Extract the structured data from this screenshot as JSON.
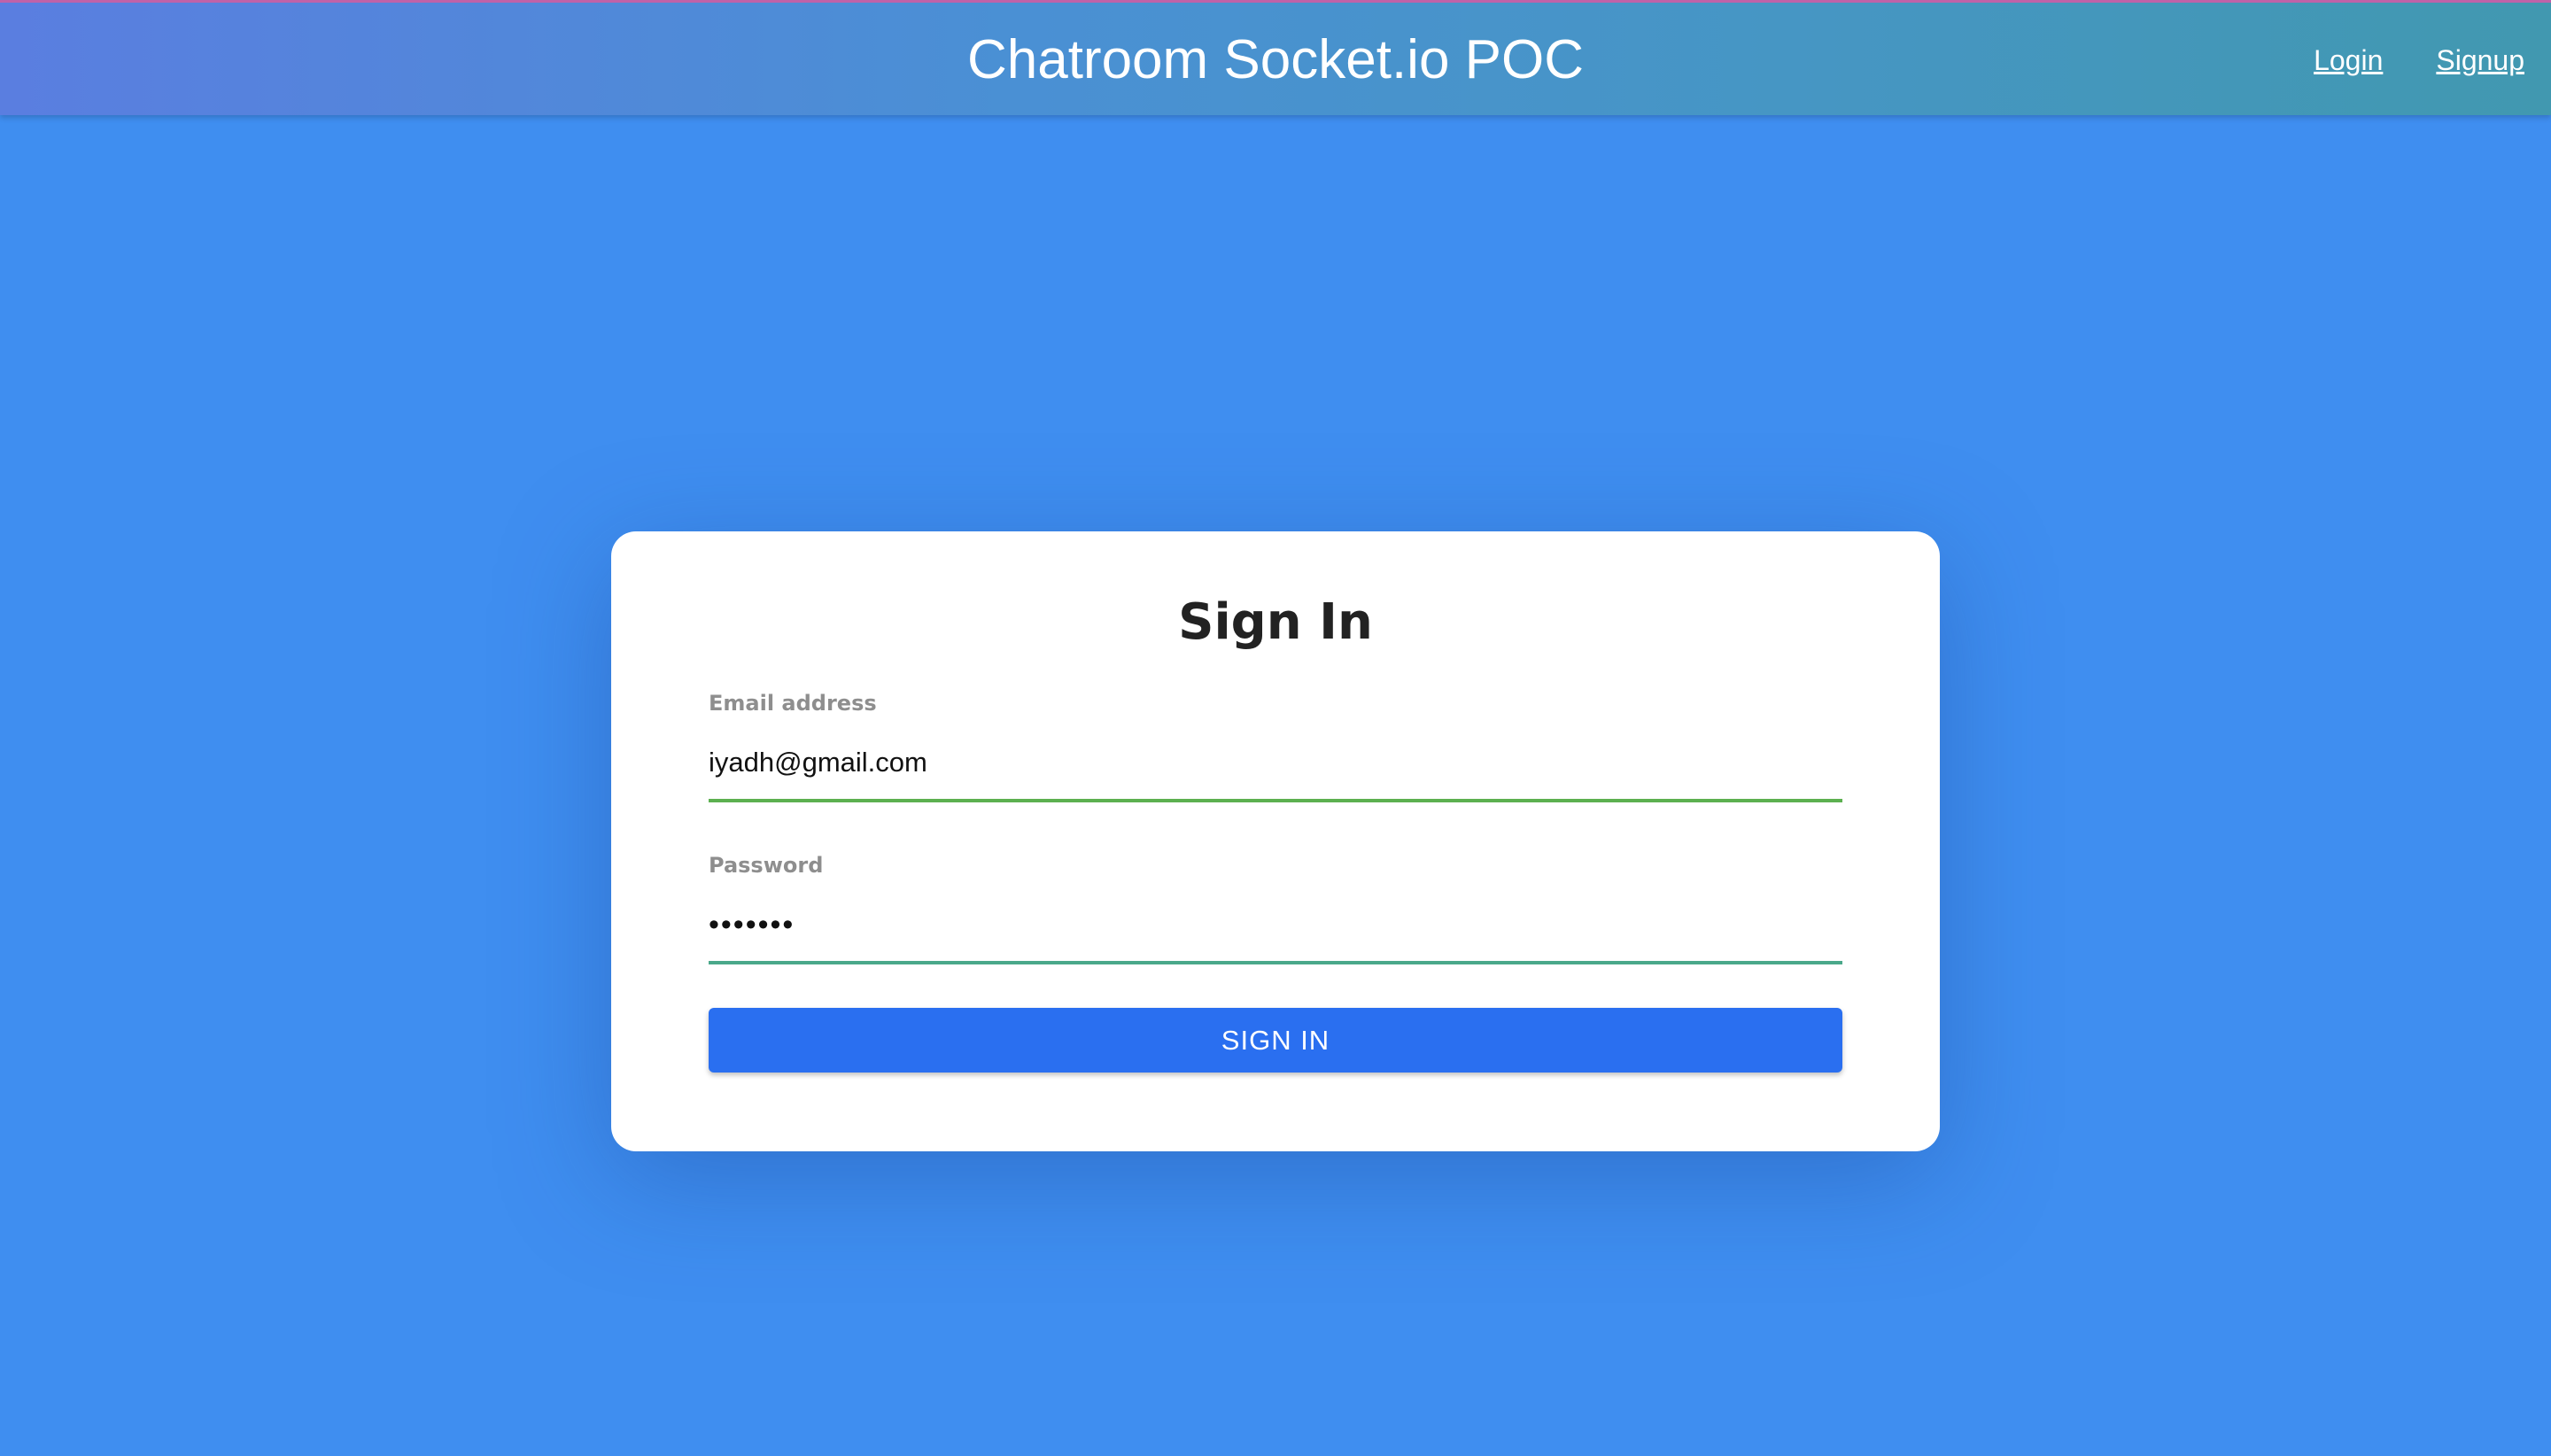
{
  "navbar": {
    "title": "Chatroom Socket.io POC",
    "links": [
      {
        "label": "Login"
      },
      {
        "label": "Signup"
      }
    ]
  },
  "signin_form": {
    "heading": "Sign In",
    "email": {
      "label": "Email address",
      "value": "iyadh@gmail.com"
    },
    "password": {
      "label": "Password",
      "value": "•••••••"
    },
    "submit_label": "SIGN IN"
  },
  "colors": {
    "background": "#3f8ef0",
    "button": "#2a6ff0",
    "email_underline": "#5cb050",
    "password_underline": "#4aa88a"
  }
}
